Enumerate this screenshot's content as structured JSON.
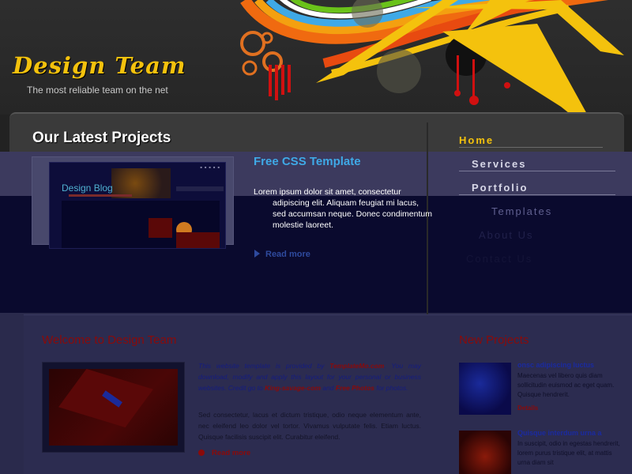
{
  "header": {
    "site_title": "Design Team",
    "slogan": "The most reliable team on the net"
  },
  "nav": {
    "items": [
      {
        "label": "Home",
        "active": true
      },
      {
        "label": "Services"
      },
      {
        "label": "Portfolio"
      },
      {
        "label": "Templates"
      },
      {
        "label": "About Us"
      },
      {
        "label": "Contact Us"
      }
    ]
  },
  "latest_projects": {
    "heading": "Our Latest Projects",
    "thumbnail_caption": "Design Blog",
    "featured_title": "Free CSS Template",
    "featured_text_line1": "Lorem ipsum dolor sit amet, consectetur",
    "featured_text_rest": "adipiscing elit. Aliquam feugiat mi lacus, sed accumsan neque. Donec condimentum molestie laoreet.",
    "read_more": "Read more"
  },
  "welcome": {
    "heading": "Welcome to Design Team",
    "intro_prefix": "This website template is provided by",
    "intro_link1": "TemplateMo.com",
    "intro_mid": ". You may download, modify and apply this layout for your personal or business websites. Credit go to",
    "intro_link2": "King-savage-com",
    "intro_and": "and",
    "intro_link3": "Free Photos",
    "intro_suffix": "for photos.",
    "body": "Sed consectetur, lacus et dictum tristique, odio neque elementum ante, nec eleifend leo dolor vel tortor. Vivamus vulputate felis. Etiam luctus. Quisque facilisis suscipit elit. Curabitur eleifend.",
    "read_more": "Read more"
  },
  "new_projects": {
    "heading": "New Projects",
    "items": [
      {
        "title": "onsc adipiscing luctus",
        "desc": "Maecenas vel libero quis diam sollicitudin euismod ac eget quam. Quisque hendrerit.",
        "link": "Details"
      },
      {
        "title": "Quisque interdum urna a",
        "desc": "In suscipit, odio in egestas hendrerit, lorem purus tristique elit, at mattis urna diam sit"
      }
    ]
  },
  "colors": {
    "accent_yellow": "#f4c20d",
    "link_blue": "#3fa9e6",
    "heading_red": "#8a0a0a"
  }
}
